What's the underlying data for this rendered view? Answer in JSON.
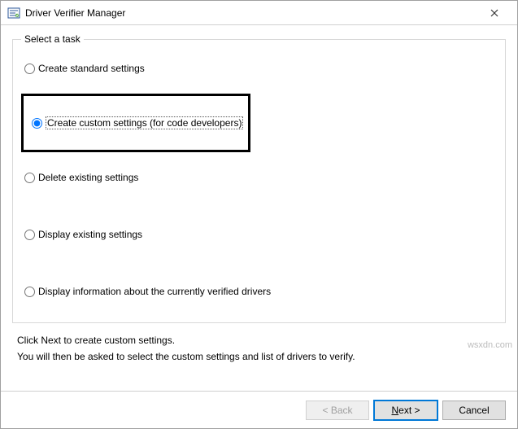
{
  "window": {
    "title": "Driver Verifier Manager"
  },
  "group": {
    "legend": "Select a task"
  },
  "options": {
    "standard": "Create standard settings",
    "custom": "Create custom settings (for code developers)",
    "delete": "Delete existing settings",
    "display_existing": "Display existing settings",
    "display_info": "Display information about the currently verified drivers"
  },
  "instructions": {
    "line1": "Click Next to create custom settings.",
    "line2": "You will then be asked to select the custom settings and list of drivers to verify."
  },
  "buttons": {
    "back": "< Back",
    "next": "Next >",
    "cancel": "Cancel"
  },
  "watermark": "wsxdn.com"
}
